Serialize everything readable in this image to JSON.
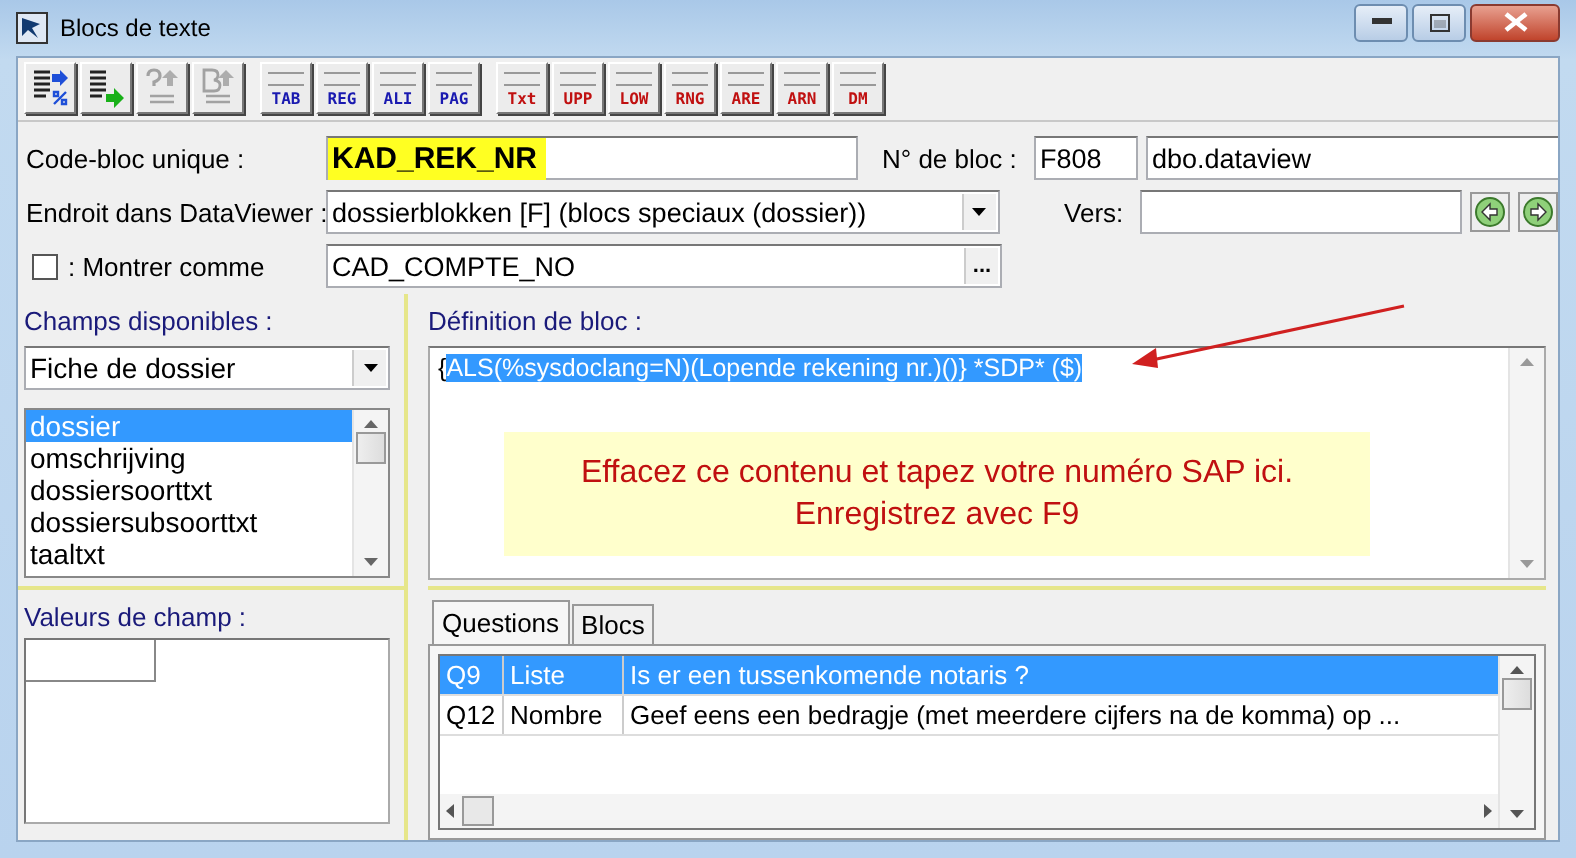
{
  "window": {
    "title": "Blocs de texte"
  },
  "toolbar": [
    {
      "kind": "icon",
      "disabled": false
    },
    {
      "kind": "icon",
      "disabled": false
    },
    {
      "kind": "icon",
      "disabled": true
    },
    {
      "kind": "icon",
      "disabled": true
    },
    {
      "kind": "label",
      "label": "TAB",
      "color": "#1a1ab0"
    },
    {
      "kind": "label",
      "label": "REG",
      "color": "#1a1ab0"
    },
    {
      "kind": "label",
      "label": "ALI",
      "color": "#1a1ab0"
    },
    {
      "kind": "label",
      "label": "PAG",
      "color": "#1a1ab0"
    },
    {
      "kind": "label",
      "label": "Txt",
      "color": "#c01010"
    },
    {
      "kind": "label",
      "label": "UPP",
      "color": "#c01010"
    },
    {
      "kind": "label",
      "label": "LOW",
      "color": "#c01010"
    },
    {
      "kind": "label",
      "label": "RNG",
      "color": "#c01010"
    },
    {
      "kind": "label",
      "label": "ARE",
      "color": "#c01010"
    },
    {
      "kind": "label",
      "label": "ARN",
      "color": "#c01010"
    },
    {
      "kind": "label",
      "label": "DM",
      "color": "#c01010"
    }
  ],
  "form": {
    "code": {
      "label": "Code-bloc unique :",
      "value": "KAD_REK_NR",
      "highlighted": true
    },
    "bloc_no": {
      "label": "N° de bloc :",
      "value": "F808"
    },
    "table_name": {
      "value": "dbo.dataview"
    },
    "location": {
      "label": "Endroit dans DataViewer :",
      "value": "dossierblokken [F] (blocs speciaux (dossier))"
    },
    "vers": {
      "label": "Vers:"
    },
    "show": {
      "label": ": Montrer comme",
      "checked": false,
      "value": "CAD_COMPTE_NO",
      "button": "..."
    }
  },
  "fields_panel": {
    "label": "Champs disponibles :",
    "source": "Fiche de dossier",
    "items": [
      {
        "name": "dossier",
        "selected": true
      },
      {
        "name": "omschrijving",
        "selected": false
      },
      {
        "name": "dossiersoorttxt",
        "selected": false
      },
      {
        "name": "dossiersubsoorttxt",
        "selected": false
      },
      {
        "name": "taaltxt",
        "selected": false
      }
    ],
    "values_label": "Valeurs de champ :"
  },
  "definition": {
    "label": "Définition de bloc :",
    "text_before": "{",
    "selected_text": "ALS(%sysdoclang=N)(Lopende rekening nr.)()} *SDP* ($)",
    "note": [
      "Effacez ce contenu et tapez votre numéro SAP ici.",
      "Enregistrez avec F9"
    ]
  },
  "tabs": [
    {
      "label": "Questions",
      "selected": true
    },
    {
      "label": "Blocs",
      "selected": false
    }
  ],
  "questions": [
    {
      "id": "Q9",
      "type": "Liste",
      "text": "Is er een tussenkomende notaris ?",
      "selected": true
    },
    {
      "id": "Q12",
      "type": "Nombre",
      "text": "Geef eens een bedragje (met meerdere cijfers na de komma) op ...",
      "selected": false
    }
  ]
}
